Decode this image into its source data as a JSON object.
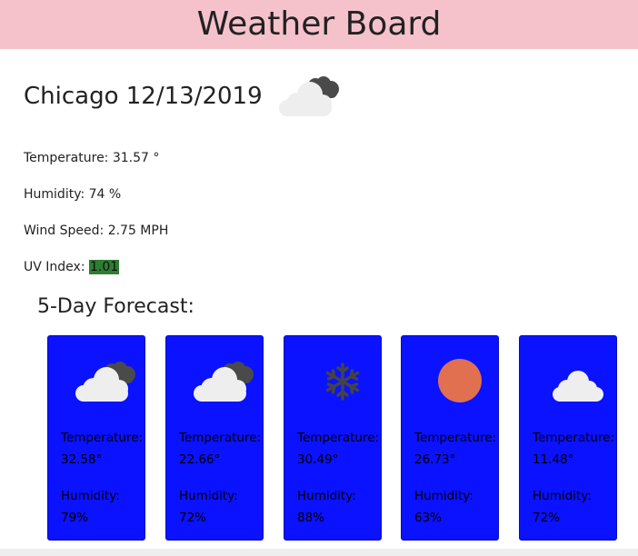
{
  "header": {
    "title": "Weather Board"
  },
  "current": {
    "title": "Chicago 12/13/2019",
    "icon": "cloudy-icon",
    "temperature": "Temperature: 31.57 °",
    "humidity": "Humidity: 74 %",
    "wind_speed": "Wind Speed: 2.75 MPH",
    "uv_label": "UV Index: ",
    "uv_value": "1.01"
  },
  "forecast": {
    "title": "5-Day Forecast:",
    "cards": [
      {
        "icon": "cloudy-icon",
        "temp_label": "Temperature:",
        "temp_value": "32.58°",
        "humidity_label": "Humidity:",
        "humidity_value": "79%"
      },
      {
        "icon": "cloudy-icon",
        "temp_label": "Temperature:",
        "temp_value": "22.66°",
        "humidity_label": "Humidity:",
        "humidity_value": "72%"
      },
      {
        "icon": "snowflake-icon",
        "temp_label": "Temperature:",
        "temp_value": "30.49°",
        "humidity_label": "Humidity:",
        "humidity_value": "88%"
      },
      {
        "icon": "sun-icon",
        "temp_label": "Temperature:",
        "temp_value": "26.73°",
        "humidity_label": "Humidity:",
        "humidity_value": "63%"
      },
      {
        "icon": "cloud-icon",
        "temp_label": "Temperature:",
        "temp_value": "11.48°",
        "humidity_label": "Humidity:",
        "humidity_value": "72%"
      }
    ]
  },
  "colors": {
    "header_bg": "#f5c2cc",
    "card_bg": "#0a12ff",
    "uv_badge": "#2e7d32",
    "sun": "#e07050"
  }
}
